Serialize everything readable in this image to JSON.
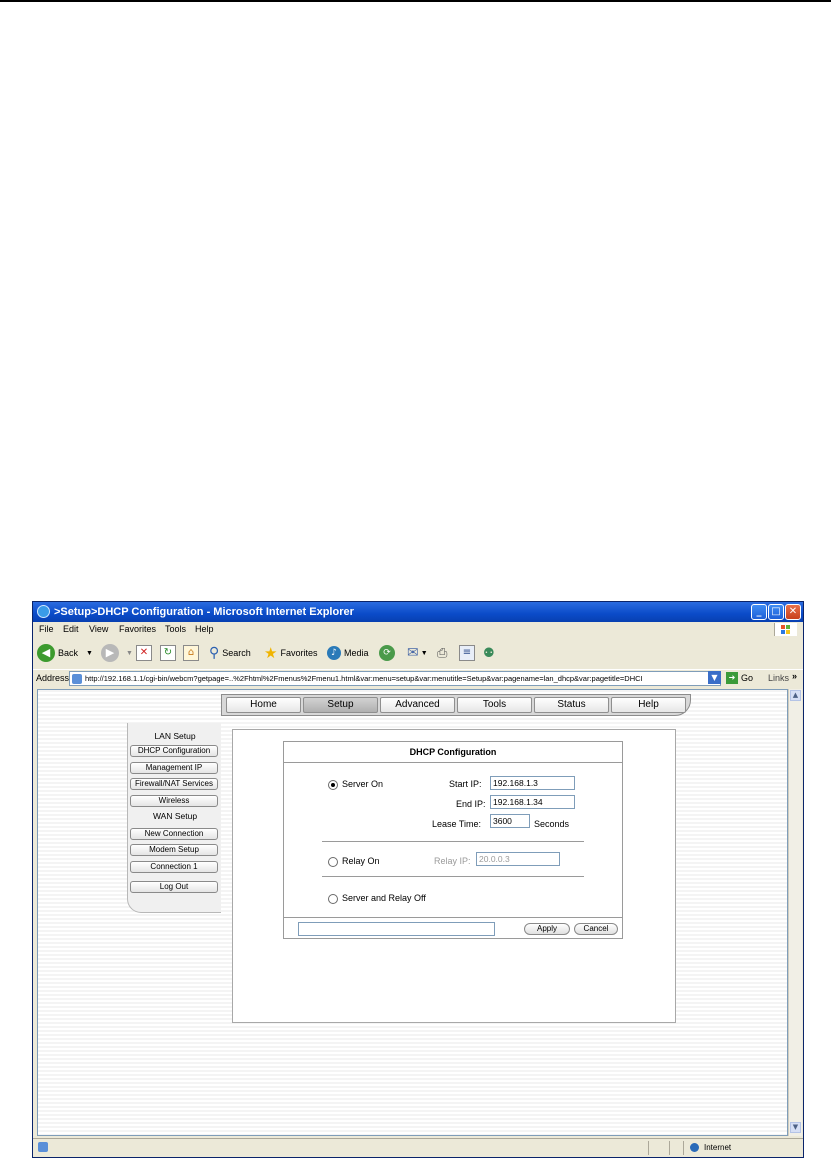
{
  "window": {
    "title": ">Setup>DHCP Configuration - Microsoft Internet Explorer",
    "controls": {
      "minimize": "_",
      "maximize": "□",
      "close": "✕"
    }
  },
  "menu": [
    "File",
    "Edit",
    "View",
    "Favorites",
    "Tools",
    "Help"
  ],
  "toolbar": {
    "back": "Back",
    "search": "Search",
    "favorites": "Favorites",
    "media": "Media"
  },
  "address": {
    "label": "Address",
    "url": "http://192.168.1.1/cgi-bin/webcm?getpage=..%2Fhtml%2Fmenus%2Fmenu1.html&var:menu=setup&var:menutitle=Setup&var:pagename=lan_dhcp&var:pagetitle=DHCI",
    "go": "Go",
    "links": "Links",
    "links_more": "»"
  },
  "nav_tabs": [
    "Home",
    "Setup",
    "Advanced",
    "Tools",
    "Status",
    "Help"
  ],
  "active_tab": "Setup",
  "side_nav": {
    "lan_heading": "LAN Setup",
    "lan_items": [
      "DHCP Configuration",
      "Management IP",
      "Firewall/NAT Services",
      "Wireless"
    ],
    "wan_heading": "WAN Setup",
    "wan_items": [
      "New Connection",
      "Modem Setup",
      "Connection 1"
    ],
    "logout": "Log Out"
  },
  "dhcp": {
    "title": "DHCP Configuration",
    "server_on_label": "Server On",
    "start_ip_label": "Start IP:",
    "start_ip": "192.168.1.3",
    "end_ip_label": "End IP:",
    "end_ip": "192.168.1.34",
    "lease_time_label": "Lease Time:",
    "lease_time": "3600",
    "lease_unit": "Seconds",
    "relay_on_label": "Relay On",
    "relay_ip_label": "Relay IP:",
    "relay_ip": "20.0.0.3",
    "off_label": "Server and Relay Off",
    "selected_mode": "Server On",
    "apply": "Apply",
    "cancel": "Cancel"
  },
  "status_bar": {
    "zone": "Internet"
  }
}
